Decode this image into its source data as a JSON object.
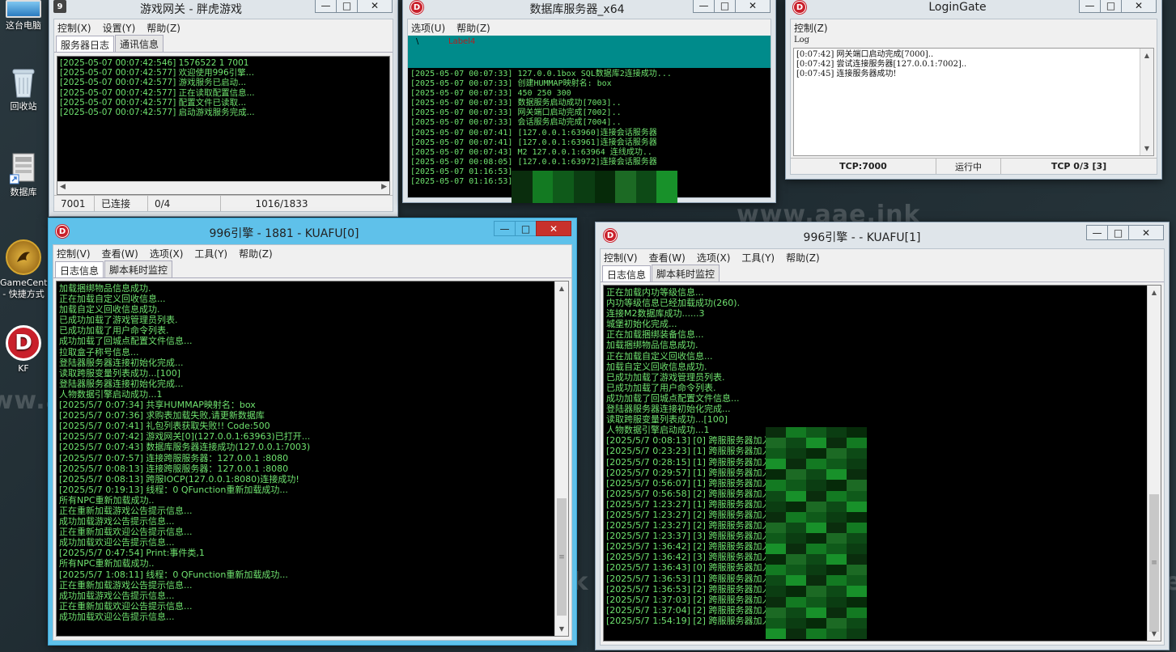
{
  "desktop": {
    "icons": [
      {
        "label": "这台电脑",
        "icon": "computer-icon"
      },
      {
        "label": "回收站",
        "icon": "recycle-bin-icon"
      },
      {
        "label": "数据库",
        "icon": "database-shortcut-icon"
      },
      {
        "label": "GameCente\n- 快捷方式",
        "icon": "gamecenter-icon"
      },
      {
        "label": "KF",
        "icon": "kf-app-icon"
      }
    ],
    "watermark": "www.aae.ink"
  },
  "gate": {
    "title": "游戏网关 - 胖虎游戏",
    "menu": [
      "控制(X)",
      "设置(Y)",
      "帮助(Z)"
    ],
    "tabs": [
      "服务器日志",
      "通讯信息"
    ],
    "lines": [
      "[2025-05-07 00:07:42:546] 1576522 1 7001",
      "[2025-05-07 00:07:42:577] 欢迎使用996引擎…",
      "[2025-05-07 00:07:42:577] 游戏服务已启动...",
      "[2025-05-07 00:07:42:577] 正在读取配置信息...",
      "[2025-05-07 00:07:42:577] 配置文件已读取...",
      "[2025-05-07 00:07:42:577] 启动游戏服务完成..."
    ],
    "status": [
      "7001",
      "已连接",
      "0/4",
      "1016/1833"
    ]
  },
  "db": {
    "title": "数据库服务器_x64",
    "menu": [
      "选项(U)",
      "帮助(Z)"
    ],
    "slash": "\\",
    "label": "Label4",
    "lines": [
      "[2025-05-07 00:07:33] 127.0.0.1box SQL数据库2连接成功...",
      "[2025-05-07 00:07:33] 创建HUMMAP映射名: box",
      "[2025-05-07 00:07:33] 450 250 300",
      "[2025-05-07 00:07:33] 数据服务启动成功[7003]..",
      "[2025-05-07 00:07:33] 网关端口启动完成[7002]..",
      "[2025-05-07 00:07:33] 会话服务启动完成[7004]..",
      "[2025-05-07 00:07:41] [127.0.0.1:63960]连接会话服务器",
      "[2025-05-07 00:07:41] [127.0.0.1:63961]连接会话服务器",
      "[2025-05-07 00:07:43] M2 127.0.0.1:63964 连线成功..",
      "[2025-05-07 00:08:05] [127.0.0.1:63972]连接会话服务器",
      "[2025-05-07 01:16:53]",
      "[2025-05-07 01:16:53]"
    ]
  },
  "login": {
    "title": "LoginGate",
    "menu": [
      "控制(Z)"
    ],
    "section": "Log",
    "lines": [
      "[0:07:42] 网关端口启动完成[7000]..",
      "[0:07:42] 尝试连接服务器[127.0.0.1:7002]..",
      "[0:07:45] 连接服务器成功!"
    ],
    "status": [
      "TCP:7000",
      "运行中",
      "TCP 0/3 [3]"
    ]
  },
  "engine0": {
    "title": "996引擎 - 1881 - KUAFU[0]",
    "menu": [
      "控制(V)",
      "查看(W)",
      "选项(X)",
      "工具(Y)",
      "帮助(Z)"
    ],
    "tabs": [
      "日志信息",
      "脚本耗时监控"
    ],
    "lines": [
      "加载捆绑物品信息成功.",
      "正在加载自定义回收信息...",
      "加载自定义回收信息成功.",
      "已成功加载了游戏管理员列表.",
      "已成功加载了用户命令列表.",
      "成功加载了回城点配置文件信息...",
      "拉取盒子称号信息...",
      "登陆器服务器连接初始化完成...",
      "读取跨服变量列表成功...[100]",
      "登陆器服务器连接初始化完成...",
      "人物数据引擎启动成功...1",
      "[2025/5/7 0:07:34] 共享HUMMAP映射名：box",
      "[2025/5/7 0:07:36] 求购表加载失败,请更新数据库",
      "[2025/5/7 0:07:41] 礼包列表获取失败!! Code:500",
      "[2025/5/7 0:07:42] 游戏网关[0](127.0.0.1:63963)已打开...",
      "[2025/5/7 0:07:43] 数据库服务器连接成功(127.0.0.1:7003)",
      "[2025/5/7 0:07:57] 连接跨服服务器：127.0.0.1 :8080",
      "[2025/5/7 0:08:13] 连接跨服服务器：127.0.0.1 :8080",
      "[2025/5/7 0:08:13] 跨服IOCP(127.0.0.1:8080)连接成功!",
      "[2025/5/7 0:19:13] 线程：0 QFunction重新加载成功...",
      "所有NPC重新加载成功..",
      "正在重新加载游戏公告提示信息...",
      "成功加载游戏公告提示信息...",
      "正在重新加载欢迎公告提示信息...",
      "成功加载欢迎公告提示信息...",
      "[2025/5/7 0:47:54] Print:事件类,1",
      "所有NPC重新加载成功..",
      "[2025/5/7 1:08:11] 线程：0 QFunction重新加载成功...",
      "正在重新加载游戏公告提示信息...",
      "成功加载游戏公告提示信息...",
      "正在重新加载欢迎公告提示信息...",
      "成功加载欢迎公告提示信息..."
    ]
  },
  "engine1": {
    "title": "996引擎 -  - KUAFU[1]",
    "menu": [
      "控制(V)",
      "查看(W)",
      "选项(X)",
      "工具(Y)",
      "帮助(Z)"
    ],
    "tabs": [
      "日志信息",
      "脚本耗时监控"
    ],
    "lines": [
      "正在加载内功等级信息...",
      "内功等级信息已经加载成功(260).",
      "连接M2数据库成功......3",
      "城堡初始化完成...",
      "正在加载捆绑装备信息...",
      "加载捆绑物品信息成功.",
      "正在加载自定义回收信息...",
      "加载自定义回收信息成功.",
      "已成功加载了游戏管理员列表.",
      "已成功加载了用户命令列表.",
      "成功加载了回城点配置文件信息...",
      "登陆器服务器连接初始化完成...",
      "读取跨服变量列表成功...[100]",
      "人物数据引擎启动成功...1",
      "[2025/5/7 0:08:13] [0] 跨服服务器加入|",
      "[2025/5/7 0:23:23] [1] 跨服服务器加入|",
      "[2025/5/7 0:28:15] [1] 跨服服务器加入|",
      "[2025/5/7 0:29:57] [1] 跨服服务器加入|",
      "[2025/5/7 0:56:07] [1] 跨服服务器加入|",
      "[2025/5/7 0:56:58] [2] 跨服服务器加入|",
      "[2025/5/7 1:23:27] [1] 跨服服务器加入|",
      "[2025/5/7 1:23:27] [2] 跨服服务器加入|",
      "[2025/5/7 1:23:27] [2] 跨服服务器加入|",
      "[2025/5/7 1:23:37] [3] 跨服服务器加入|",
      "[2025/5/7 1:36:42] [2] 跨服服务器加入|",
      "[2025/5/7 1:36:42] [3] 跨服服务器加入|",
      "[2025/5/7 1:36:43] [0] 跨服服务器加入|",
      "[2025/5/7 1:36:53] [1] 跨服服务器加入|",
      "[2025/5/7 1:36:53] [2] 跨服服务器加入|",
      "[2025/5/7 1:37:03] [2] 跨服服务器加入|",
      "[2025/5/7 1:37:04] [2] 跨服服务器加入|",
      "[2025/5/7 1:54:19] [2] 跨服服务器加入|"
    ]
  },
  "colors": {
    "log_text": "#6fe36f",
    "db_header": "#008b8b",
    "active_title": "#5fc1ea",
    "close_red": "#c8312b"
  }
}
